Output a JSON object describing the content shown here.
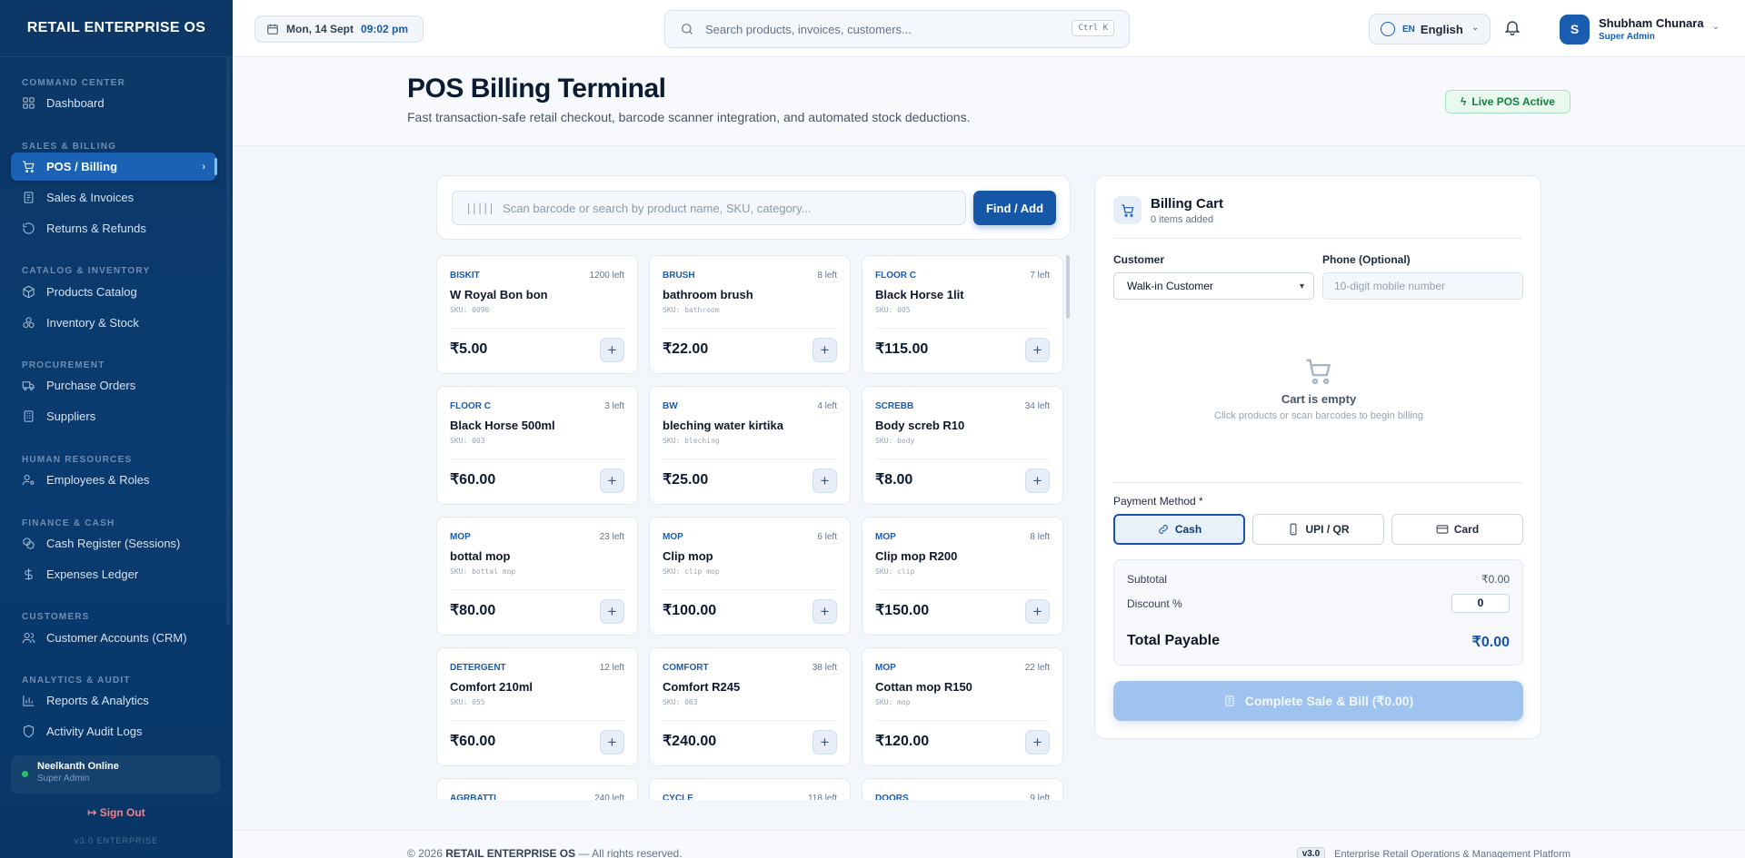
{
  "brand": "RETAIL ENTERPRISE OS",
  "sidebar": {
    "sections": [
      {
        "title": "COMMAND CENTER",
        "items": [
          {
            "label": "Dashboard",
            "icon": "grid-icon"
          }
        ]
      },
      {
        "title": "SALES & BILLING",
        "items": [
          {
            "label": "POS / Billing",
            "icon": "cart-icon",
            "active": true
          },
          {
            "label": "Sales & Invoices",
            "icon": "receipt-icon"
          },
          {
            "label": "Returns & Refunds",
            "icon": "rotate-icon"
          }
        ]
      },
      {
        "title": "CATALOG & INVENTORY",
        "items": [
          {
            "label": "Products Catalog",
            "icon": "box-icon"
          },
          {
            "label": "Inventory & Stock",
            "icon": "boxes-icon"
          }
        ]
      },
      {
        "title": "PROCUREMENT",
        "items": [
          {
            "label": "Purchase Orders",
            "icon": "truck-icon"
          },
          {
            "label": "Suppliers",
            "icon": "building-icon"
          }
        ]
      },
      {
        "title": "HUMAN RESOURCES",
        "items": [
          {
            "label": "Employees & Roles",
            "icon": "user-cog-icon"
          }
        ]
      },
      {
        "title": "FINANCE & CASH",
        "items": [
          {
            "label": "Cash Register (Sessions)",
            "icon": "coins-icon"
          },
          {
            "label": "Expenses Ledger",
            "icon": "dollar-icon"
          }
        ]
      },
      {
        "title": "CUSTOMERS",
        "items": [
          {
            "label": "Customer Accounts (CRM)",
            "icon": "users-icon"
          }
        ]
      },
      {
        "title": "ANALYTICS & AUDIT",
        "items": [
          {
            "label": "Reports & Analytics",
            "icon": "bar-chart-icon"
          },
          {
            "label": "Activity Audit Logs",
            "icon": "shield-icon"
          }
        ]
      }
    ],
    "status": {
      "name": "Neelkanth Online",
      "role": "Super Admin"
    },
    "sign_out": "Sign Out",
    "version": "v3.0 ENTERPRISE"
  },
  "topbar": {
    "date": "Mon, 14 Sept",
    "time": "09:02 pm",
    "search_placeholder": "Search products, invoices, customers...",
    "shortcut": "Ctrl K",
    "lang_code": "EN",
    "language": "English",
    "user_initial": "S",
    "user_name": "Shubham Chunara",
    "user_role": "Super Admin"
  },
  "page": {
    "title": "POS Billing Terminal",
    "subtitle": "Fast transaction-safe retail checkout, barcode scanner integration, and automated stock deductions.",
    "live_badge": "Live POS Active"
  },
  "scanner": {
    "placeholder": "Scan barcode or search by product name, SKU, category...",
    "button": "Find / Add"
  },
  "products": [
    {
      "category": "BISKIT",
      "stock": "1200 left",
      "name": "W Royal Bon bon",
      "sku": "SKU: 0096",
      "price": "₹5.00"
    },
    {
      "category": "BRUSH",
      "stock": "8 left",
      "name": "bathroom brush",
      "sku": "SKU: bathroom",
      "price": "₹22.00"
    },
    {
      "category": "FLOOR C",
      "stock": "7 left",
      "name": "Black Horse 1lit",
      "sku": "SKU: 005",
      "price": "₹115.00"
    },
    {
      "category": "FLOOR C",
      "stock": "3 left",
      "name": "Black Horse 500ml",
      "sku": "SKU: 003",
      "price": "₹60.00"
    },
    {
      "category": "BW",
      "stock": "4 left",
      "name": "bleching water kirtika",
      "sku": "SKU: bleching",
      "price": "₹25.00"
    },
    {
      "category": "SCREBB",
      "stock": "34 left",
      "name": "Body screb R10",
      "sku": "SKU: body",
      "price": "₹8.00"
    },
    {
      "category": "MOP",
      "stock": "23 left",
      "name": "bottal mop",
      "sku": "SKU: bottal mop",
      "price": "₹80.00"
    },
    {
      "category": "MOP",
      "stock": "6 left",
      "name": "Clip mop",
      "sku": "SKU: clip mop",
      "price": "₹100.00"
    },
    {
      "category": "MOP",
      "stock": "8 left",
      "name": "Clip mop R200",
      "sku": "SKU: clip",
      "price": "₹150.00"
    },
    {
      "category": "DETERGENT",
      "stock": "12 left",
      "name": "Comfort 210ml",
      "sku": "SKU: 055",
      "price": "₹60.00"
    },
    {
      "category": "COMFORT",
      "stock": "38 left",
      "name": "Comfort R245",
      "sku": "SKU: 063",
      "price": "₹240.00"
    },
    {
      "category": "MOP",
      "stock": "22 left",
      "name": "Cottan mop R150",
      "sku": "SKU: mop",
      "price": "₹120.00"
    },
    {
      "category": "AGRBATTI",
      "stock": "240 left",
      "name": "",
      "sku": "",
      "price": ""
    },
    {
      "category": "CYCLE",
      "stock": "118 left",
      "name": "",
      "sku": "",
      "price": ""
    },
    {
      "category": "DOORS",
      "stock": "9 left",
      "name": "",
      "sku": "",
      "price": ""
    }
  ],
  "cart": {
    "title": "Billing Cart",
    "count": "0 items added",
    "customer_label": "Customer",
    "customer_value": "Walk-in Customer",
    "phone_label": "Phone (Optional)",
    "phone_placeholder": "10-digit mobile number",
    "empty_title": "Cart is empty",
    "empty_sub": "Click products or scan barcodes to begin billing",
    "payment_label": "Payment Method *",
    "payment_methods": [
      {
        "label": "Cash",
        "icon": "link-icon",
        "selected": true
      },
      {
        "label": "UPI / QR",
        "icon": "smartphone-icon"
      },
      {
        "label": "Card",
        "icon": "credit-card-icon"
      }
    ],
    "subtotal_label": "Subtotal",
    "subtotal": "₹0.00",
    "discount_label": "Discount %",
    "discount": "0",
    "total_label": "Total Payable",
    "total": "₹0.00",
    "complete_button": "Complete Sale & Bill (₹0.00)"
  },
  "footer": {
    "copyright_prefix": "© 2026",
    "copyright_brand": "RETAIL ENTERPRISE OS",
    "copyright_suffix": "— All rights reserved.",
    "version": "v3.0",
    "tagline": "Enterprise Retail Operations & Management Platform"
  },
  "colors": {
    "sidebar": "#0a3b70",
    "accent": "#1556a6",
    "active": "#1b62b5",
    "success": "#15803d"
  }
}
